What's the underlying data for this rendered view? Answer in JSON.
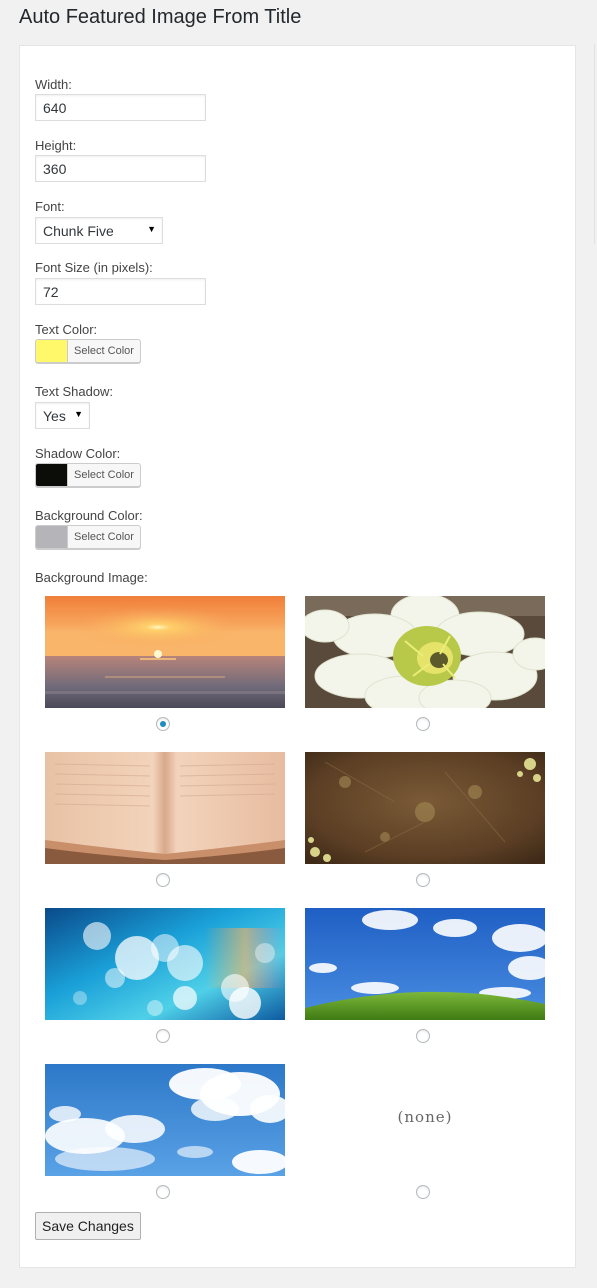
{
  "page": {
    "title": "Auto Featured Image From Title"
  },
  "form": {
    "width": {
      "label": "Width:",
      "value": "640"
    },
    "height": {
      "label": "Height:",
      "value": "360"
    },
    "font": {
      "label": "Font:",
      "selected": "Chunk Five"
    },
    "font_size": {
      "label": "Font Size (in pixels):",
      "value": "72"
    },
    "text_color": {
      "label": "Text Color:",
      "button_label": "Select Color",
      "color": "#fff86a"
    },
    "text_shadow": {
      "label": "Text Shadow:",
      "selected": "Yes"
    },
    "shadow_color": {
      "label": "Shadow Color:",
      "button_label": "Select Color",
      "color": "#0c0c08"
    },
    "background_color": {
      "label": "Background Color:",
      "button_label": "Select Color",
      "color": "#b5b4b8"
    },
    "background_image": {
      "label": "Background Image:",
      "options": [
        {
          "name": "sunset",
          "checked": true
        },
        {
          "name": "flower",
          "checked": false
        },
        {
          "name": "book",
          "checked": false
        },
        {
          "name": "grunge",
          "checked": false
        },
        {
          "name": "bokeh",
          "checked": false
        },
        {
          "name": "hill",
          "checked": false
        },
        {
          "name": "clouds",
          "checked": false
        },
        {
          "name": "none",
          "checked": false,
          "text": "(none)"
        }
      ]
    },
    "save_label": "Save Changes"
  },
  "colors": {
    "accent": "#1e8cbe",
    "panel_border": "#e5e5e5",
    "background": "#f1f1f1"
  }
}
